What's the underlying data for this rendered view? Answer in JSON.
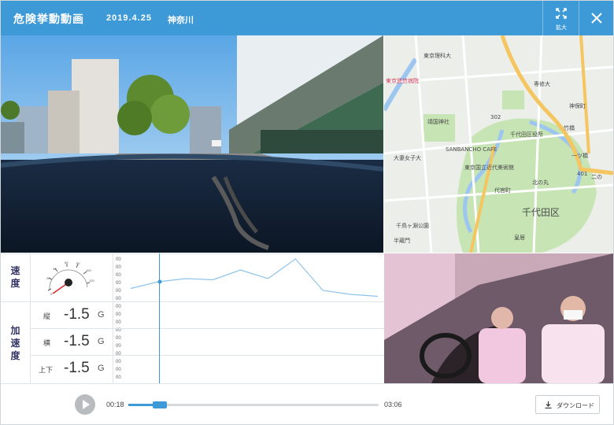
{
  "header": {
    "title": "危険挙動動画",
    "date": "2019.4.25",
    "place": "神奈川",
    "expand_label": "拡大"
  },
  "map": {
    "labels": [
      {
        "text": "東京理科大"
      },
      {
        "text": "東京逓信病院"
      },
      {
        "text": "専修大"
      },
      {
        "text": "神保町"
      },
      {
        "text": "靖国神社"
      },
      {
        "text": "千代田区役所"
      },
      {
        "text": "SANBANCHO CAFE"
      },
      {
        "text": "大妻女子大"
      },
      {
        "text": "東京国立近代美術館"
      },
      {
        "text": "代官町"
      },
      {
        "text": "北の丸"
      },
      {
        "text": "千代田区"
      },
      {
        "text": "千鳥ヶ淵公園"
      },
      {
        "text": "皇居"
      },
      {
        "text": "半蔵門"
      },
      {
        "text": "一ツ橋"
      },
      {
        "text": "竹橋"
      },
      {
        "text": "二の"
      },
      {
        "text": "302"
      },
      {
        "text": "401"
      }
    ]
  },
  "sensors": {
    "speed_label": [
      "速",
      "度"
    ],
    "accel_label": [
      "加",
      "速",
      "度"
    ],
    "accel": [
      {
        "axis": "縦",
        "value": "-1.5",
        "unit": "G"
      },
      {
        "axis": "横",
        "value": "-1.5",
        "unit": "G"
      },
      {
        "axis": "上下",
        "value": "-1.5",
        "unit": "G"
      }
    ],
    "gauge_ticks": [
      "20",
      "40",
      "60",
      "80",
      "100",
      "120",
      "0"
    ],
    "speed_chart": {
      "type": "line",
      "ytick_label": "00",
      "values": [
        0.25,
        0.42,
        0.5,
        0.47,
        0.72,
        0.5,
        1.0,
        0.2,
        0.1,
        0.05
      ],
      "ylim": [
        0,
        1
      ]
    },
    "accel_ytick_label": "00"
  },
  "playback": {
    "current": "00:18",
    "total": "03:06",
    "progress": 0.097,
    "download_label": "ダウンロード"
  }
}
